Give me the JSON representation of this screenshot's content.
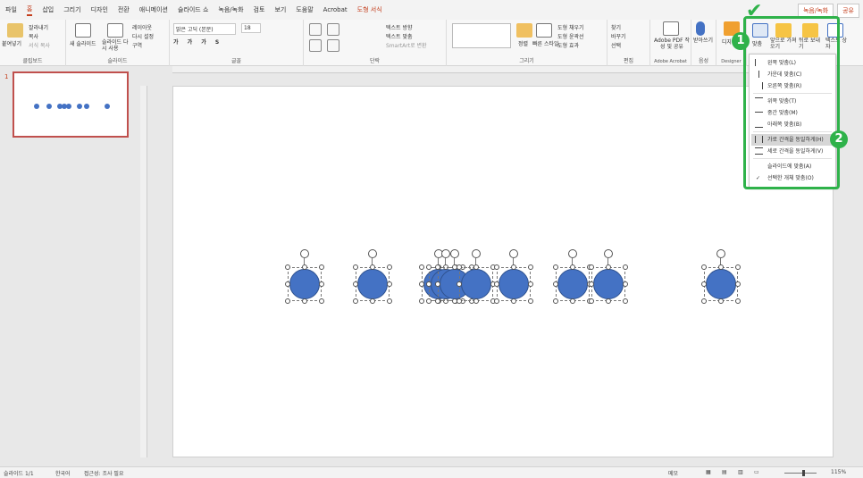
{
  "menubar": {
    "items": [
      "파일",
      "홈",
      "삽입",
      "그리기",
      "디자인",
      "전환",
      "애니메이션",
      "슬라이드 쇼",
      "녹음/녹화",
      "검토",
      "보기",
      "도움말",
      "Acrobat",
      "도형 서식"
    ],
    "record_label": "녹음/녹화",
    "share_label": "공유"
  },
  "ribbon": {
    "clipboard": {
      "paste": "붙여넣기",
      "cut": "잘라내기",
      "copy": "복사",
      "format_painter": "서식 복사",
      "label": "클립보드"
    },
    "slides": {
      "new_slide": "새 슬라이드",
      "reuse": "슬라이드 다시 사용",
      "layout": "레이아웃",
      "reset": "다시 설정",
      "section": "구역",
      "label": "슬라이드"
    },
    "font": {
      "name": "맑은 고딕 (본문)",
      "size": "18",
      "label": "글꼴"
    },
    "paragraph": {
      "text_direction": "텍스트 방향",
      "align_text": "텍스트 맞춤",
      "smartart": "SmartArt로 변환",
      "label": "단락"
    },
    "drawing": {
      "arrange": "정렬",
      "quick_styles": "빠른 스타일",
      "fill": "도형 채우기",
      "outline": "도형 윤곽선",
      "effects": "도형 효과",
      "label": "그리기"
    },
    "editing": {
      "find": "찾기",
      "replace": "바꾸기",
      "select": "선택",
      "label": "편집"
    },
    "acrobat": {
      "create": "Adobe PDF 작성 및 공유",
      "label": "Adobe Acrobat"
    },
    "voice": {
      "dictate": "받아쓰기",
      "label": "음성"
    },
    "designer": {
      "label": "Designer",
      "ideas": "디자인 아이디어"
    },
    "arrange_group": {
      "align": "맞춤",
      "bring_forward": "앞으로 가져오기",
      "send_backward": "뒤로 보내기",
      "textbox": "텍스트 상자"
    }
  },
  "slide_panel": {
    "slide_number": "1"
  },
  "align_menu": {
    "items": [
      {
        "label": "왼쪽 맞춤(L)",
        "highlighted": false
      },
      {
        "label": "가운데 맞춤(C)",
        "highlighted": false
      },
      {
        "label": "오른쪽 맞춤(R)",
        "highlighted": false
      },
      {
        "label": "위쪽 맞춤(T)",
        "highlighted": false
      },
      {
        "label": "중간 맞춤(M)",
        "highlighted": false
      },
      {
        "label": "아래쪽 맞춤(B)",
        "highlighted": false
      },
      {
        "label": "가로 간격을 동일하게(H)",
        "highlighted": true
      },
      {
        "label": "세로 간격을 동일하게(V)",
        "highlighted": false
      },
      {
        "label": "슬라이드에 맞춤(A)",
        "highlighted": false
      },
      {
        "label": "선택한 개체 맞춤(O)",
        "highlighted": false,
        "checked": true
      }
    ]
  },
  "callouts": {
    "step1": "1",
    "step2": "2",
    "check_glyph": "✔"
  },
  "statusbar": {
    "slide_count": "슬라이드 1/1",
    "language": "한국어",
    "accessibility": "접근성: 조사 필요",
    "notes": "메모",
    "zoom": "115%"
  },
  "colors": {
    "shape_fill": "#4472c4",
    "accent": "#c43e1c",
    "callout": "#2fb24a"
  }
}
